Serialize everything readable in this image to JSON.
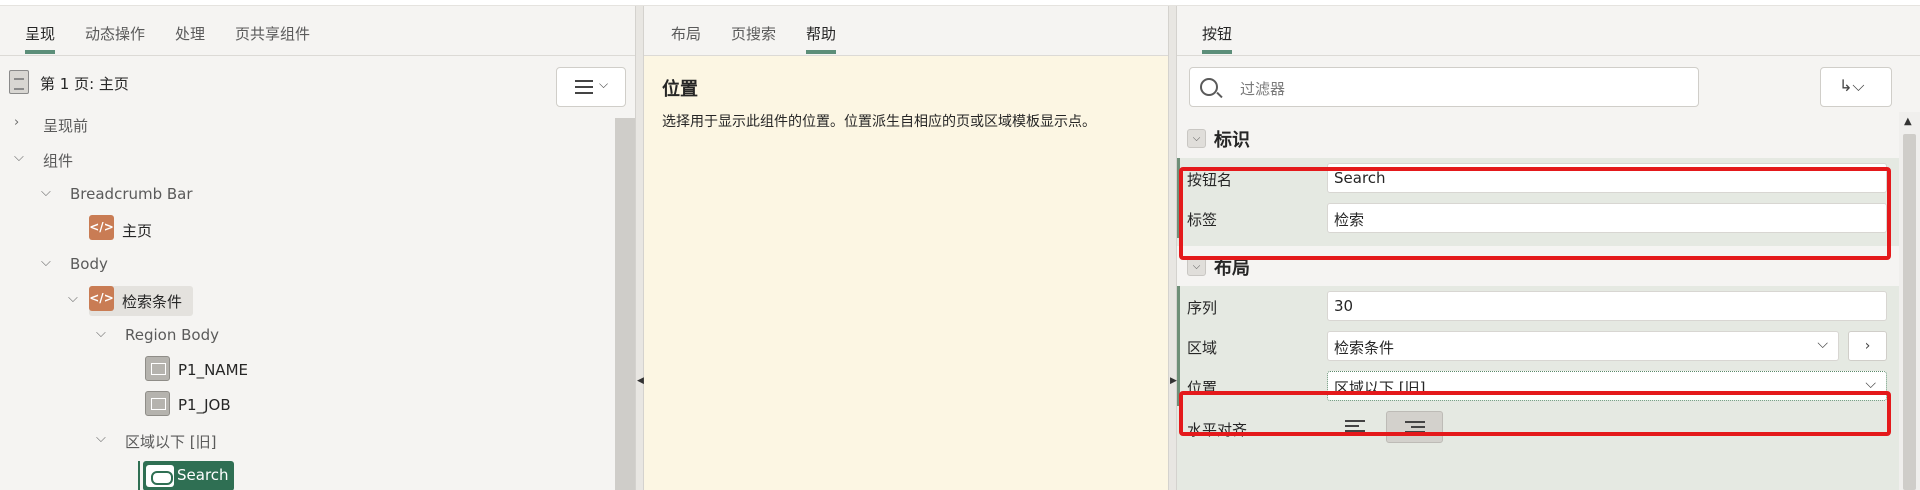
{
  "left": {
    "tabs": [
      "呈现",
      "动态操作",
      "处理",
      "页共享组件"
    ],
    "active_tab": "呈现",
    "page_title": "第 1 页: 主页",
    "menu_icon": "hamburger-menu-icon",
    "tree": {
      "pre_render": "呈现前",
      "components": "组件",
      "breadcrumb_bar": "Breadcrumb Bar",
      "home": "主页",
      "body": "Body",
      "search_criteria": "检索条件",
      "region_body": "Region Body",
      "p1_name": "P1_NAME",
      "p1_job": "P1_JOB",
      "below_region": "区域以下 [旧]",
      "search": "Search"
    }
  },
  "middle": {
    "tabs": [
      "布局",
      "页搜索",
      "帮助"
    ],
    "active_tab": "帮助",
    "help_title": "位置",
    "help_text": "选择用于显示此组件的位置。位置派生自相应的页或区域模板显示点。"
  },
  "right": {
    "tab": "按钮",
    "filter_placeholder": "过滤器",
    "sections": {
      "identification": {
        "title": "标识",
        "button_name_label": "按钮名",
        "button_name_value": "Search",
        "label_label": "标签",
        "label_value": "检索"
      },
      "layout": {
        "title": "布局",
        "sequence_label": "序列",
        "sequence_value": "30",
        "region_label": "区域",
        "region_value": "检索条件",
        "position_label": "位置",
        "position_value": "区域以下 [旧]",
        "h_align_label": "水平对齐",
        "h_align_selected": "right"
      }
    },
    "colors": {
      "accent": "#5c8e79",
      "selected_node": "#2f6f53",
      "highlight_box": "#e4191b",
      "help_bg": "#fcf6e3"
    }
  }
}
